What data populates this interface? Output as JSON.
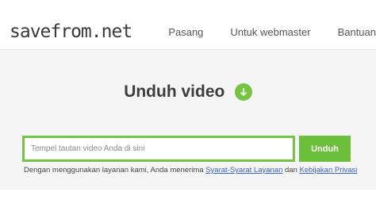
{
  "header": {
    "logo": "savefrom.net",
    "nav": [
      "Pasang",
      "Untuk webmaster",
      "Bantuan"
    ]
  },
  "main": {
    "title": "Unduh video",
    "input_placeholder": "Tempel tautan video Anda di sini",
    "submit_label": "Unduh",
    "terms_prefix": "Dengan menggunakan layanan kami, Anda menerima ",
    "terms_link": "Syarat-Syarat Layanan",
    "terms_and": " dan ",
    "privacy_link": "Kebijakan Privasi"
  },
  "colors": {
    "accent": "#76c441",
    "link": "#3b63c4"
  }
}
